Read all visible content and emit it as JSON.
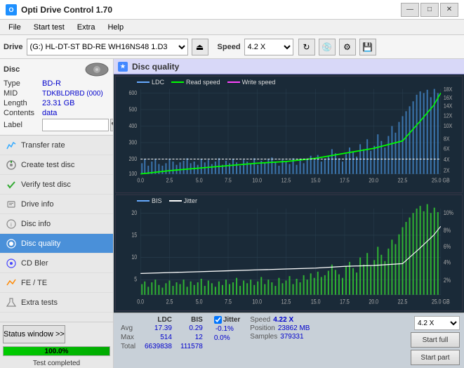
{
  "titleBar": {
    "title": "Opti Drive Control 1.70",
    "minimize": "—",
    "maximize": "□",
    "close": "✕"
  },
  "menuBar": {
    "items": [
      "File",
      "Start test",
      "Extra",
      "Help"
    ]
  },
  "toolbar": {
    "driveLabel": "Drive",
    "driveValue": "(G:)  HL-DT-ST BD-RE  WH16NS48 1.D3",
    "speedLabel": "Speed",
    "speedValue": "4.2 X"
  },
  "sidebar": {
    "discPanel": {
      "title": "Disc",
      "typeLabel": "Type",
      "typeValue": "BD-R",
      "midLabel": "MID",
      "midValue": "TDKBLDRBD (000)",
      "lengthLabel": "Length",
      "lengthValue": "23.31 GB",
      "contentsLabel": "Contents",
      "contentsValue": "data",
      "labelLabel": "Label",
      "labelValue": ""
    },
    "navItems": [
      {
        "id": "transfer-rate",
        "label": "Transfer rate",
        "icon": "📈"
      },
      {
        "id": "create-test-disc",
        "label": "Create test disc",
        "icon": "💿"
      },
      {
        "id": "verify-test-disc",
        "label": "Verify test disc",
        "icon": "✔"
      },
      {
        "id": "drive-info",
        "label": "Drive info",
        "icon": "ℹ"
      },
      {
        "id": "disc-info",
        "label": "Disc info",
        "icon": "📋"
      },
      {
        "id": "disc-quality",
        "label": "Disc quality",
        "icon": "★",
        "active": true
      },
      {
        "id": "cd-bler",
        "label": "CD Bler",
        "icon": "🔵"
      },
      {
        "id": "fe-te",
        "label": "FE / TE",
        "icon": "📉"
      },
      {
        "id": "extra-tests",
        "label": "Extra tests",
        "icon": "🔧"
      }
    ],
    "statusWindowBtn": "Status window >>",
    "progressValue": 100,
    "progressText": "100.0%",
    "statusText": "Test completed"
  },
  "chart": {
    "title": "Disc quality",
    "legend1": {
      "ldc": "LDC",
      "readSpeed": "Read speed",
      "writeSpeed": "Write speed"
    },
    "legend2": {
      "bis": "BIS",
      "jitter": "Jitter"
    },
    "yAxis1": [
      "600",
      "500",
      "400",
      "300",
      "200",
      "100"
    ],
    "yAxis1Right": [
      "18X",
      "16X",
      "14X",
      "12X",
      "10X",
      "8X",
      "6X",
      "4X",
      "2X"
    ],
    "yAxis2": [
      "20",
      "15",
      "10",
      "5"
    ],
    "yAxis2Right": [
      "10%",
      "8%",
      "6%",
      "4%",
      "2%"
    ],
    "xLabels": [
      "0.0",
      "2.5",
      "5.0",
      "7.5",
      "10.0",
      "12.5",
      "15.0",
      "17.5",
      "20.0",
      "22.5",
      "25.0 GB"
    ]
  },
  "statsBar": {
    "headers": [
      "LDC",
      "BIS"
    ],
    "rows": [
      {
        "label": "Avg",
        "ldc": "17.39",
        "bis": "0.29",
        "jitterLabel": "Jitter",
        "jitterVal": "-0.1%"
      },
      {
        "label": "Max",
        "ldc": "514",
        "bis": "12",
        "jitterVal": "0.0%"
      },
      {
        "label": "Total",
        "ldc": "6639838",
        "bis": "111578",
        "jitterVal": ""
      }
    ],
    "speedLabel": "Speed",
    "speedValue": "4.22 X",
    "speedSelect": "4.2 X",
    "positionLabel": "Position",
    "positionValue": "23862 MB",
    "samplesLabel": "Samples",
    "samplesValue": "379331",
    "startFull": "Start full",
    "startPart": "Start part"
  }
}
